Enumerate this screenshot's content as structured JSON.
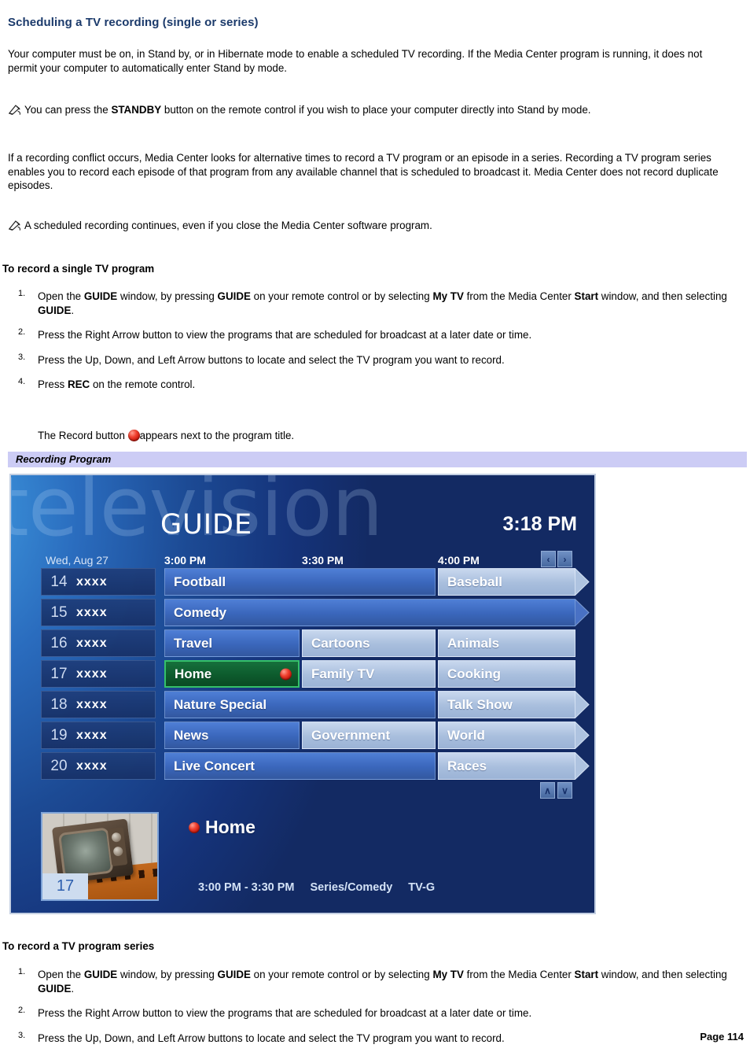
{
  "document": {
    "title": "Scheduling a TV recording (single or series)",
    "title_color": "#1b3a6b",
    "intro_paragraph": "Your computer must be on, in Stand by, or in Hibernate mode to enable a scheduled TV recording. If the Media Center program is running, it does not permit your computer to automatically enter Stand by mode.",
    "note1_pre": "You can press the ",
    "note1_bold": "STANDBY",
    "note1_post": " button on the remote control if you wish to place your computer directly into Stand by mode.",
    "paragraph2": "If a recording conflict occurs, Media Center looks for alternative times to record a TV program or an episode in a series. Recording a TV program series enables you to record each episode of that program from any available channel that is scheduled to broadcast it. Media Center does not record duplicate episodes.",
    "note2": "A scheduled recording continues, even if you close the Media Center software program.",
    "page_number": "Page 114"
  },
  "section_single": {
    "heading": "To record a single TV program",
    "steps": [
      {
        "num": "1.",
        "parts": [
          {
            "t": "Open the ",
            "b": false
          },
          {
            "t": "GUIDE",
            "b": true
          },
          {
            "t": " window, by pressing ",
            "b": false
          },
          {
            "t": "GUIDE",
            "b": true
          },
          {
            "t": " on your remote control or by selecting ",
            "b": false
          },
          {
            "t": "My TV",
            "b": true
          },
          {
            "t": " from the Media Center ",
            "b": false
          },
          {
            "t": "Start",
            "b": true
          },
          {
            "t": " window, and then selecting ",
            "b": false
          },
          {
            "t": "GUIDE",
            "b": true
          },
          {
            "t": ".",
            "b": false
          }
        ]
      },
      {
        "num": "2.",
        "parts": [
          {
            "t": "Press the Right Arrow button to view the programs that are scheduled for broadcast at a later date or time.",
            "b": false
          }
        ]
      },
      {
        "num": "3.",
        "parts": [
          {
            "t": "Press the Up, Down, and Left Arrow buttons to locate and select the TV program you want to record.",
            "b": false
          }
        ]
      },
      {
        "num": "4.",
        "parts": [
          {
            "t": "Press ",
            "b": false
          },
          {
            "t": "REC",
            "b": true
          },
          {
            "t": " on the remote control.",
            "b": false
          }
        ]
      }
    ],
    "record_line_pre": "The Record button ",
    "record_line_post": "appears next to the program title."
  },
  "section_series": {
    "heading": "To record a TV program series",
    "steps": [
      {
        "num": "1.",
        "parts": [
          {
            "t": "Open the ",
            "b": false
          },
          {
            "t": "GUIDE",
            "b": true
          },
          {
            "t": " window, by pressing ",
            "b": false
          },
          {
            "t": "GUIDE",
            "b": true
          },
          {
            "t": " on your remote control or by selecting ",
            "b": false
          },
          {
            "t": "My TV",
            "b": true
          },
          {
            "t": " from the Media Center ",
            "b": false
          },
          {
            "t": "Start",
            "b": true
          },
          {
            "t": " window, and then selecting ",
            "b": false
          },
          {
            "t": "GUIDE",
            "b": true
          },
          {
            "t": ".",
            "b": false
          }
        ]
      },
      {
        "num": "2.",
        "parts": [
          {
            "t": "Press the Right Arrow button to view the programs that are scheduled for broadcast at a later date or time.",
            "b": false
          }
        ]
      },
      {
        "num": "3.",
        "parts": [
          {
            "t": "Press the Up, Down, and Left Arrow buttons to locate and select the TV program you want to record.",
            "b": false
          }
        ]
      }
    ]
  },
  "figure": {
    "caption": "Recording Program"
  },
  "media_center": {
    "watermark": "television",
    "title": "GUIDE",
    "clock": "3:18 PM",
    "date": "Wed, Aug 27",
    "time_slots": [
      "3:00 PM",
      "3:30 PM",
      "4:00 PM"
    ],
    "pager_prev": "‹",
    "pager_next": "›",
    "pager_up": "∧",
    "pager_down": "∨",
    "rows": [
      {
        "channel": "14",
        "callsign": "xxxx",
        "cells": [
          {
            "label": "Football",
            "style": "dark",
            "start": 0,
            "span": 2,
            "continues": false,
            "recording": false
          },
          {
            "label": "Baseball",
            "style": "light",
            "start": 2,
            "span": 1,
            "continues": true,
            "recording": false
          }
        ]
      },
      {
        "channel": "15",
        "callsign": "xxxx",
        "cells": [
          {
            "label": "Comedy",
            "style": "dark",
            "start": 0,
            "span": 3,
            "continues": true,
            "recording": false
          }
        ]
      },
      {
        "channel": "16",
        "callsign": "xxxx",
        "cells": [
          {
            "label": "Travel",
            "style": "dark",
            "start": 0,
            "span": 1,
            "continues": false,
            "recording": false
          },
          {
            "label": "Cartoons",
            "style": "light",
            "start": 1,
            "span": 1,
            "continues": false,
            "recording": false
          },
          {
            "label": "Animals",
            "style": "light",
            "start": 2,
            "span": 1,
            "continues": false,
            "recording": false
          }
        ]
      },
      {
        "channel": "17",
        "callsign": "xxxx",
        "cells": [
          {
            "label": "Home",
            "style": "sel",
            "start": 0,
            "span": 1,
            "continues": false,
            "recording": true
          },
          {
            "label": "Family TV",
            "style": "light",
            "start": 1,
            "span": 1,
            "continues": false,
            "recording": false
          },
          {
            "label": "Cooking",
            "style": "light",
            "start": 2,
            "span": 1,
            "continues": false,
            "recording": false
          }
        ]
      },
      {
        "channel": "18",
        "callsign": "xxxx",
        "cells": [
          {
            "label": "Nature Special",
            "style": "dark",
            "start": 0,
            "span": 2,
            "continues": false,
            "recording": false
          },
          {
            "label": "Talk Show",
            "style": "light",
            "start": 2,
            "span": 1,
            "continues": true,
            "recording": false
          }
        ]
      },
      {
        "channel": "19",
        "callsign": "xxxx",
        "cells": [
          {
            "label": "News",
            "style": "dark",
            "start": 0,
            "span": 1,
            "continues": false,
            "recording": false
          },
          {
            "label": "Government",
            "style": "light",
            "start": 1,
            "span": 1,
            "continues": false,
            "recording": false
          },
          {
            "label": "World",
            "style": "light",
            "start": 2,
            "span": 1,
            "continues": true,
            "recording": false
          }
        ]
      },
      {
        "channel": "20",
        "callsign": "xxxx",
        "cells": [
          {
            "label": "Live Concert",
            "style": "dark",
            "start": 0,
            "span": 2,
            "continues": false,
            "recording": false
          },
          {
            "label": "Races",
            "style": "light",
            "start": 2,
            "span": 1,
            "continues": true,
            "recording": false
          }
        ]
      }
    ],
    "detail": {
      "program_title": "Home",
      "thumb_channel": "17",
      "time_range": "3:00 PM - 3:30 PM",
      "genre": "Series/Comedy",
      "rating": "TV-G"
    }
  }
}
